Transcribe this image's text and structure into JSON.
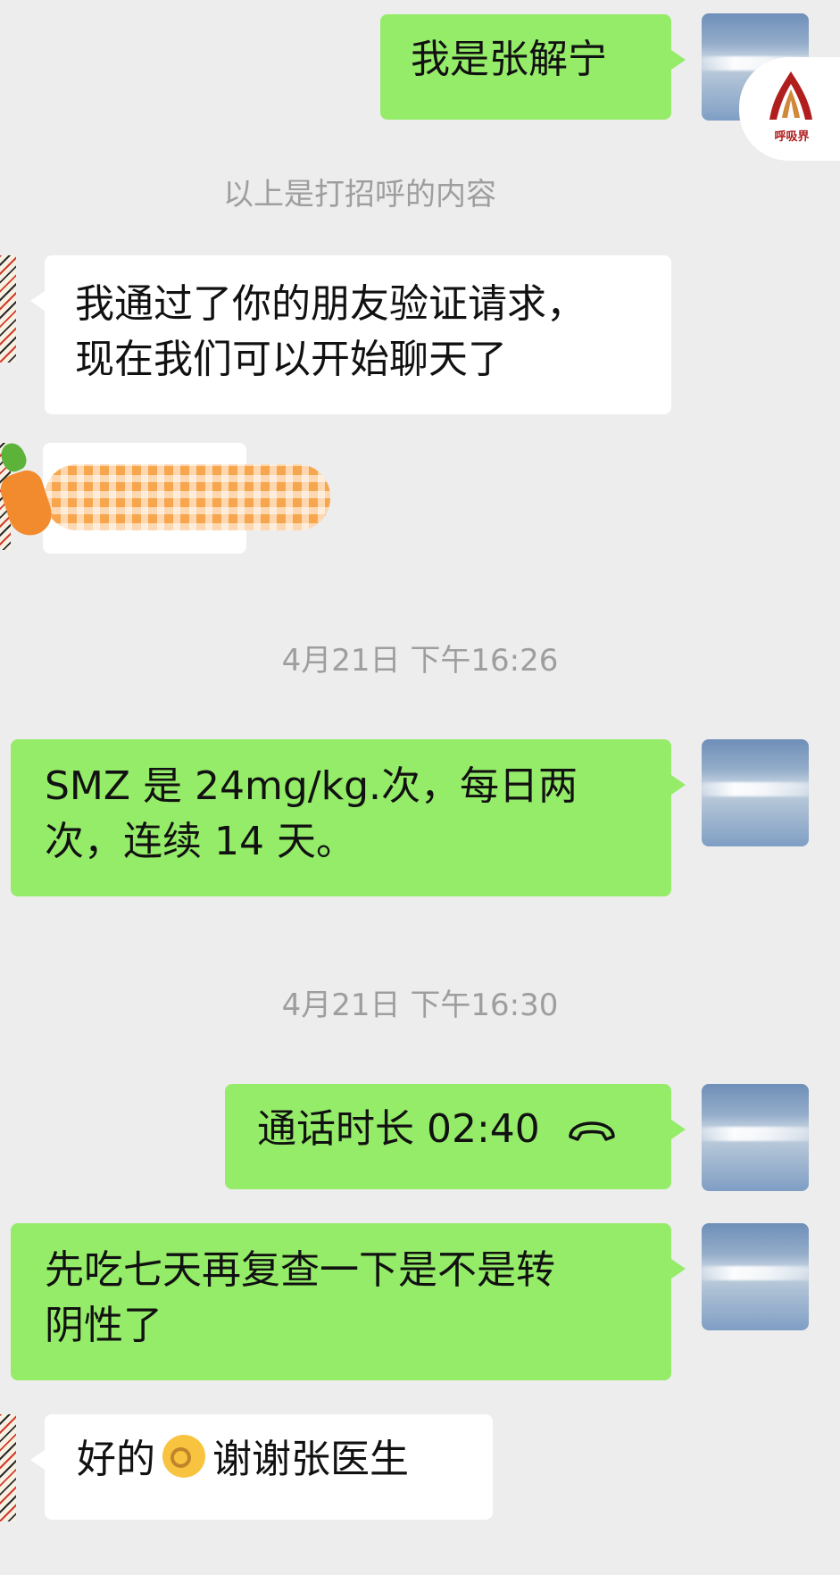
{
  "messages": {
    "m1_text": "我是张解宁",
    "greeting_note": "以上是打招呼的内容",
    "m2_line1": "我通过了你的朋友验证请求，",
    "m2_line2": "现在我们可以开始聊天了",
    "ts1": "4月21日 下午16:26",
    "m3_line1": "SMZ 是 24mg/kg.次，每日两",
    "m3_line2": "次，连续 14 天。",
    "ts2": "4月21日 下午16:30",
    "call_label": "通话时长 02:40",
    "m5_line1": "先吃七天再复查一下是不是转",
    "m5_line2": "阴性了",
    "m6_part1": "好的",
    "m6_part2": "谢谢张医生"
  },
  "logo": {
    "text": "呼吸界"
  },
  "colors": {
    "background": "#ededed",
    "bubble_green": "#95ec69",
    "bubble_white": "#ffffff",
    "system_text": "#9e9e9e"
  },
  "icons": {
    "call": "phone-handset-icon",
    "ok_hand": "ok-hand-emoji-icon",
    "logo": "breath-circle-logo-icon"
  }
}
